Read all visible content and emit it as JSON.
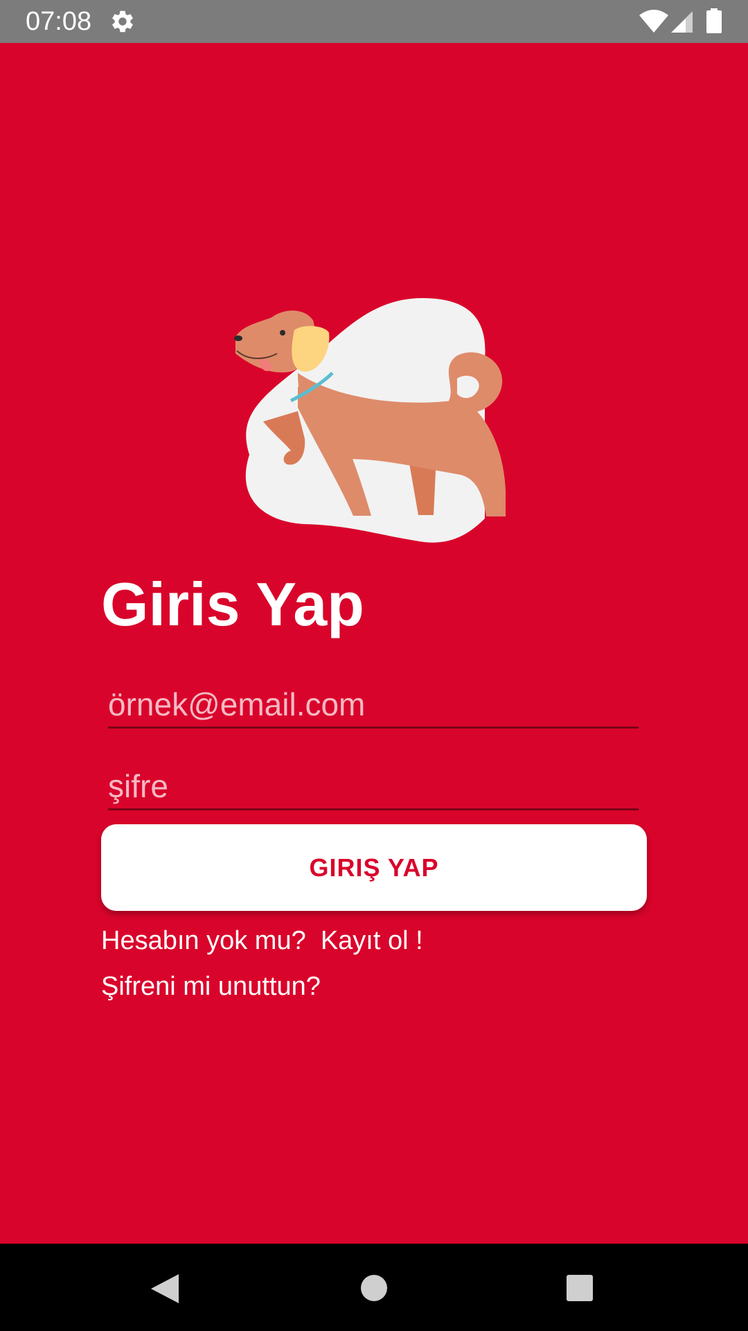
{
  "status_bar": {
    "time": "07:08",
    "icons": [
      "gear-icon",
      "wifi-icon",
      "signal-icon",
      "battery-icon"
    ]
  },
  "login": {
    "title": "Giris Yap",
    "email_placeholder": "örnek@email.com",
    "email_value": "",
    "password_placeholder": "şifre",
    "password_value": "",
    "submit_label": "GIRIŞ YAP",
    "signup_prompt": "Hesabın yok mu?  ",
    "signup_link": "Kayıt ol !",
    "forgot_link": "Şifreni mi unuttun?"
  },
  "illustration": {
    "icon": "dog-illustration"
  },
  "nav_bar": {
    "icons": [
      "back-icon",
      "home-icon",
      "recents-icon"
    ]
  },
  "colors": {
    "background": "#d9042b",
    "status_bar": "#7c7c7c",
    "button_bg": "#ffffff",
    "button_text": "#d9042b",
    "nav_bar": "#000000",
    "dog_body": "#de8b6a",
    "dog_ear": "#fdd480",
    "collar": "#5bbdd1",
    "blob": "#f2f2f2"
  }
}
